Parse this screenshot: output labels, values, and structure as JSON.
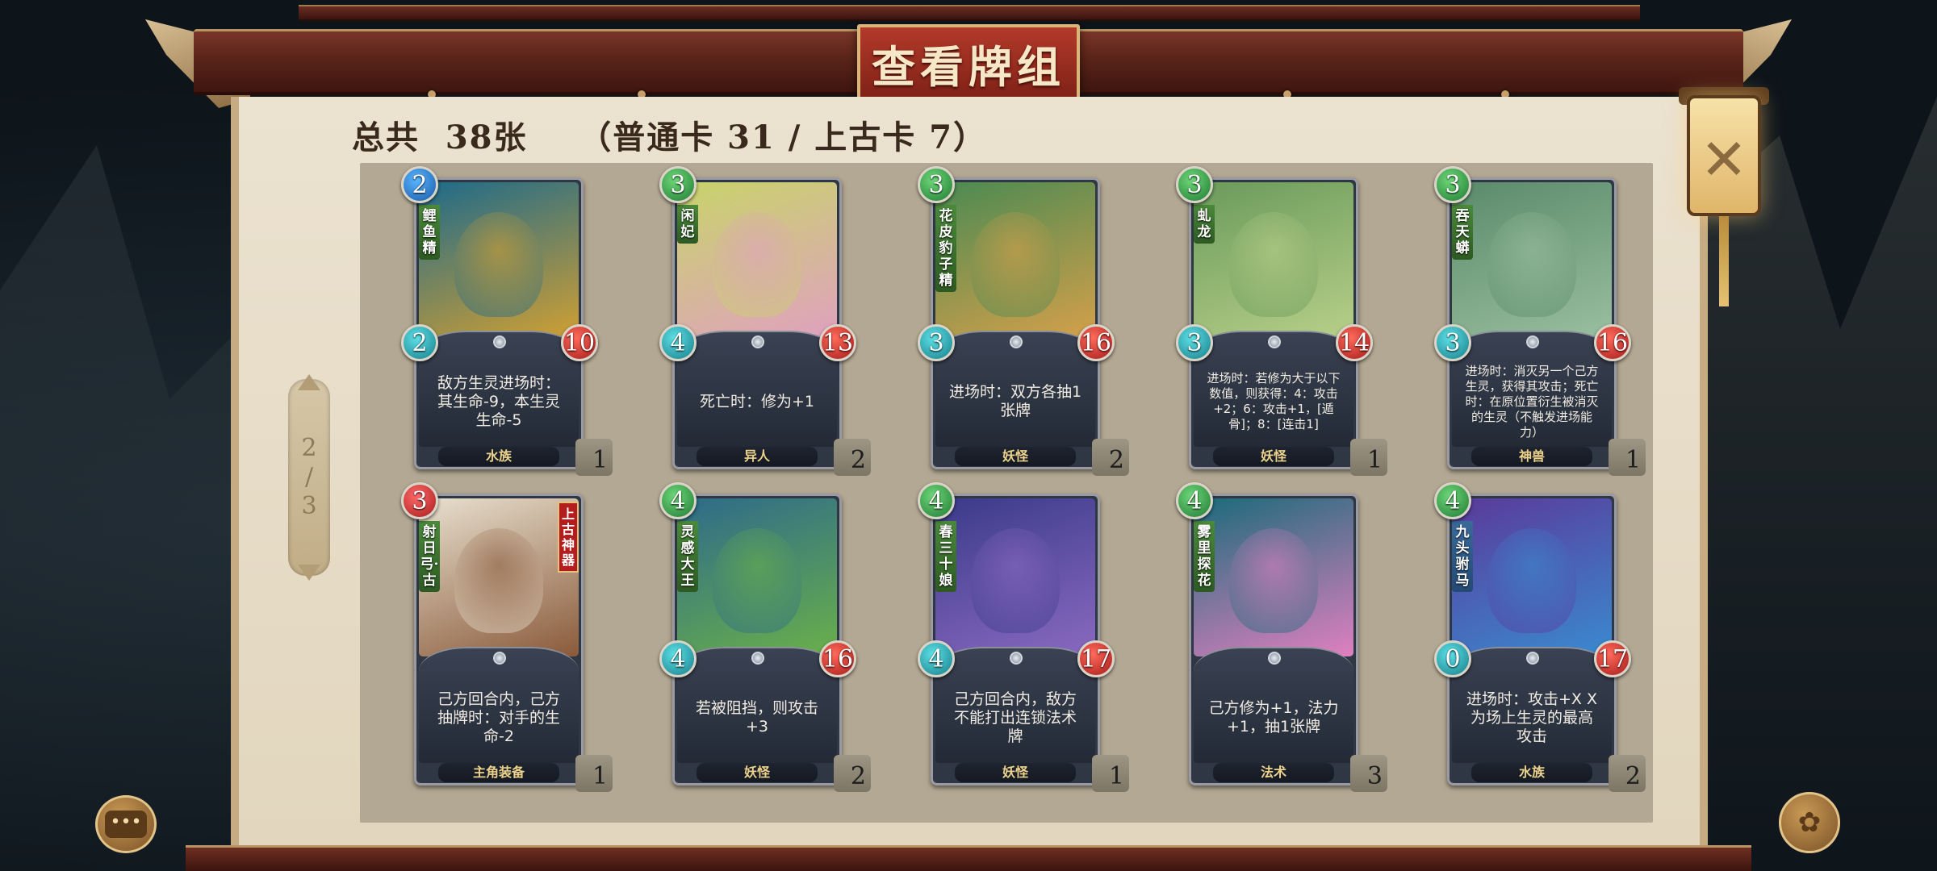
{
  "header": {
    "title": "查看牌组"
  },
  "summary": {
    "text": "总共  38张    （普通卡 31 / 上古卡 7）"
  },
  "pager": {
    "current": "2",
    "sep": "/",
    "total": "3"
  },
  "close": {
    "label": "✕"
  },
  "chat": {
    "label": "•••"
  },
  "menu": {
    "label": "✿"
  },
  "cards": [
    {
      "name": "鲤鱼精",
      "cost": "2",
      "attack": "2",
      "health": "10",
      "desc": "敌方生灵进场时：其生命-9，本生灵生命-5",
      "type": "水族",
      "count": "1",
      "art": [
        "#1d6a8a",
        "#d2a032"
      ]
    },
    {
      "name": "闲妃",
      "cost": "3",
      "attack": "4",
      "health": "13",
      "desc": "死亡时：修为+1",
      "type": "异人",
      "count": "2",
      "art": [
        "#c8d46a",
        "#e0a0c0"
      ]
    },
    {
      "name": "花皮豹子精",
      "cost": "3",
      "attack": "3",
      "health": "16",
      "desc": "进场时：双方各抽1张牌",
      "type": "妖怪",
      "count": "2",
      "art": [
        "#4a8a52",
        "#d6a04a"
      ]
    },
    {
      "name": "虬龙",
      "cost": "3",
      "attack": "3",
      "health": "14",
      "desc": "进场时：若修为大于以下数值，则获得：4：攻击+2；6：攻击+1，[遁骨]；8：[连击1]",
      "type": "妖怪",
      "count": "1",
      "art": [
        "#6a9a5a",
        "#b8d08a"
      ]
    },
    {
      "name": "吞天蟒",
      "cost": "3",
      "attack": "3",
      "health": "16",
      "desc": "进场时：消灭另一个己方生灵，获得其攻击；死亡时：在原位置衍生被消灭的生灵（不触发进场能力）",
      "type": "神兽",
      "count": "1",
      "art": [
        "#5a8a6a",
        "#9ac0a0"
      ]
    },
    {
      "name": "射日弓·古",
      "cost": "3",
      "attack": "",
      "health": "",
      "desc": "己方回合内，己方抽牌时：对手的生命-2",
      "type": "主角装备",
      "count": "1",
      "relic": "上古神器",
      "art": [
        "#e8e0cf",
        "#8a5a3a"
      ]
    },
    {
      "name": "灵感大王",
      "cost": "4",
      "attack": "4",
      "health": "16",
      "desc": "若被阻挡，则攻击+3",
      "type": "妖怪",
      "count": "2",
      "art": [
        "#2d6a8a",
        "#6ab04a"
      ]
    },
    {
      "name": "春三十娘",
      "cost": "4",
      "attack": "4",
      "health": "17",
      "desc": "己方回合内，敌方不能打出连锁法术牌",
      "type": "妖怪",
      "count": "1",
      "art": [
        "#3a3a8a",
        "#8a6ac0"
      ]
    },
    {
      "name": "雾里探花",
      "cost": "4",
      "attack": "",
      "health": "",
      "desc": "己方修为+1，法力+1，抽1张牌",
      "type": "法术",
      "count": "3",
      "art": [
        "#1a6a7a",
        "#e080c0"
      ]
    },
    {
      "name": "九头驸马",
      "cost": "4",
      "attack": "0",
      "health": "17",
      "desc": "进场时：攻击+X X为场上生灵的最高攻击",
      "type": "水族",
      "count": "2",
      "art": [
        "#5a3a9a",
        "#3a8ad0"
      ]
    }
  ]
}
